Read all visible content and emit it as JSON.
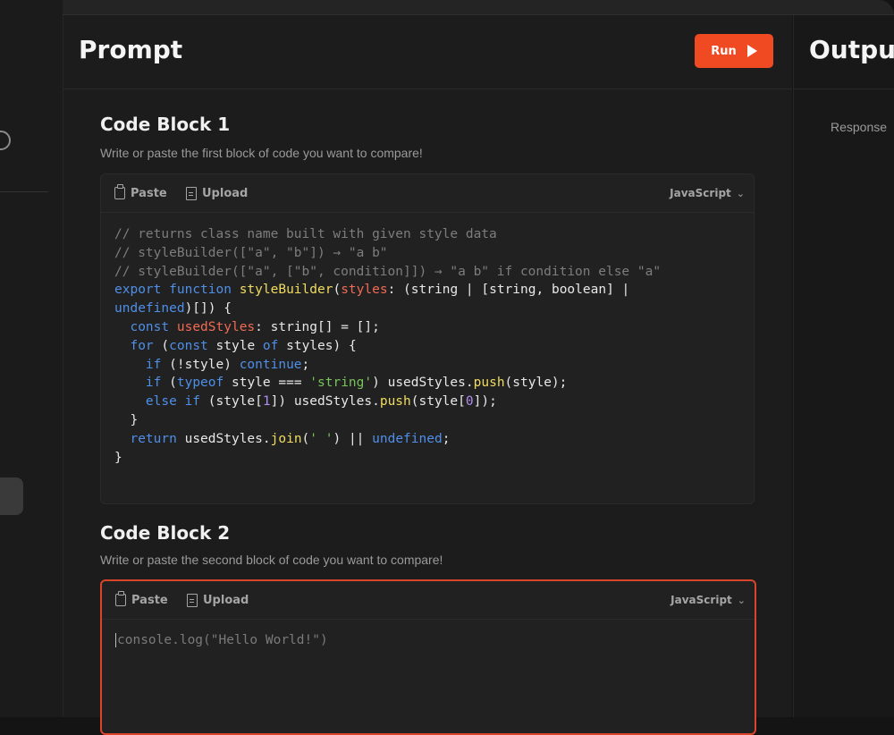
{
  "prompt": {
    "title": "Prompt",
    "run_label": "Run"
  },
  "output": {
    "title": "Output",
    "response_label": "Response"
  },
  "code_blocks": [
    {
      "title": "Code Block 1",
      "description": "Write or paste the first block of code you want to compare!",
      "paste_label": "Paste",
      "upload_label": "Upload",
      "language": "JavaScript",
      "code": "// returns class name built with given style data\n// styleBuilder([\"a\", \"b\"]) → \"a b\"\n// styleBuilder([\"a\", [\"b\", condition]]) → \"a b\" if condition else \"a\"\nexport function styleBuilder(styles: (string | [string, boolean] |\nundefined)[]) {\n  const usedStyles: string[] = [];\n  for (const style of styles) {\n    if (!style) continue;\n    if (typeof style === 'string') usedStyles.push(style);\n    else if (style[1]) usedStyles.push(style[0]);\n  }\n  return usedStyles.join(' ') || undefined;\n}"
    },
    {
      "title": "Code Block 2",
      "description": "Write or paste the second block of code you want to compare!",
      "paste_label": "Paste",
      "upload_label": "Upload",
      "language": "JavaScript",
      "placeholder": "console.log(\"Hello World!\")"
    }
  ],
  "colors": {
    "accent": "#f04a23",
    "active_border": "#d9452a",
    "keyword": "#4f8fe8",
    "function": "#f0dc60",
    "variable": "#f06a54",
    "string": "#79c35a",
    "number": "#b18ef0",
    "comment": "#7d7d7d"
  }
}
